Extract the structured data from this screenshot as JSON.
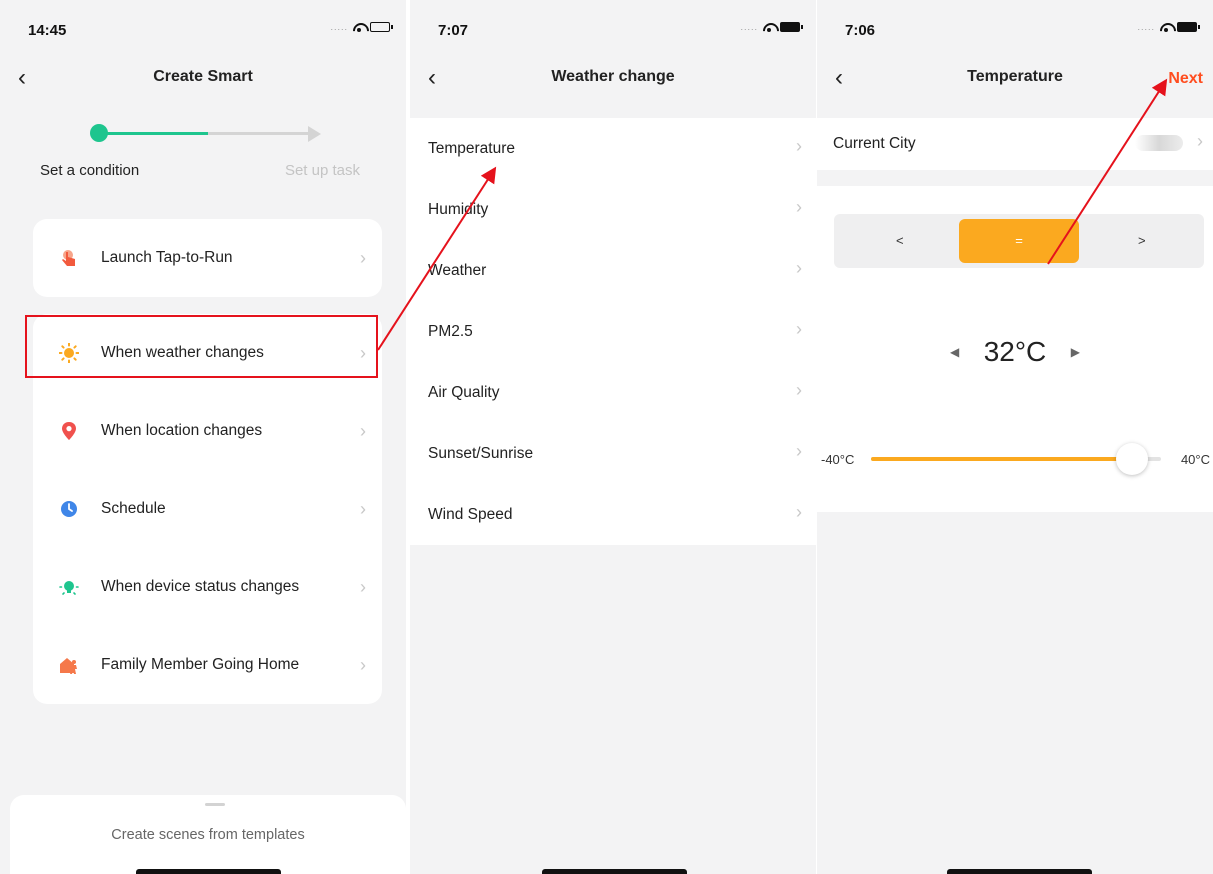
{
  "screen1": {
    "time": "14:45",
    "title": "Create Smart",
    "step1_label": "Set a condition",
    "step2_label": "Set up task",
    "tap_to_run": {
      "label": "Launch Tap-to-Run",
      "icon": "hand-tap-icon"
    },
    "conditions": [
      {
        "label": "When weather changes",
        "icon": "sun-icon",
        "color": "#fba91f"
      },
      {
        "label": "When location changes",
        "icon": "location-pin-icon",
        "color": "#f0514d"
      },
      {
        "label": "Schedule",
        "icon": "clock-icon",
        "color": "#3f86e8"
      },
      {
        "label": "When device status changes",
        "icon": "device-bulb-icon",
        "color": "#1ec58e"
      },
      {
        "label": "Family Member Going Home",
        "icon": "person-home-icon",
        "color": "#f5784a"
      }
    ],
    "templates_label": "Create scenes from templates"
  },
  "screen2": {
    "time": "7:07",
    "title": "Weather change",
    "items": [
      "Temperature",
      "Humidity",
      "Weather",
      "PM2.5",
      "Air Quality",
      "Sunset/Sunrise",
      "Wind Speed"
    ]
  },
  "screen3": {
    "time": "7:06",
    "title": "Temperature",
    "next_label": "Next",
    "current_city_label": "Current City",
    "operators": [
      "<",
      "=",
      ">"
    ],
    "selected_operator": "=",
    "temperature": "32°C",
    "slider_min": "-40°C",
    "slider_max": "40°C",
    "slider_fraction": 0.9,
    "accent": "#fba91f"
  },
  "annotation_color": "#e5121c"
}
